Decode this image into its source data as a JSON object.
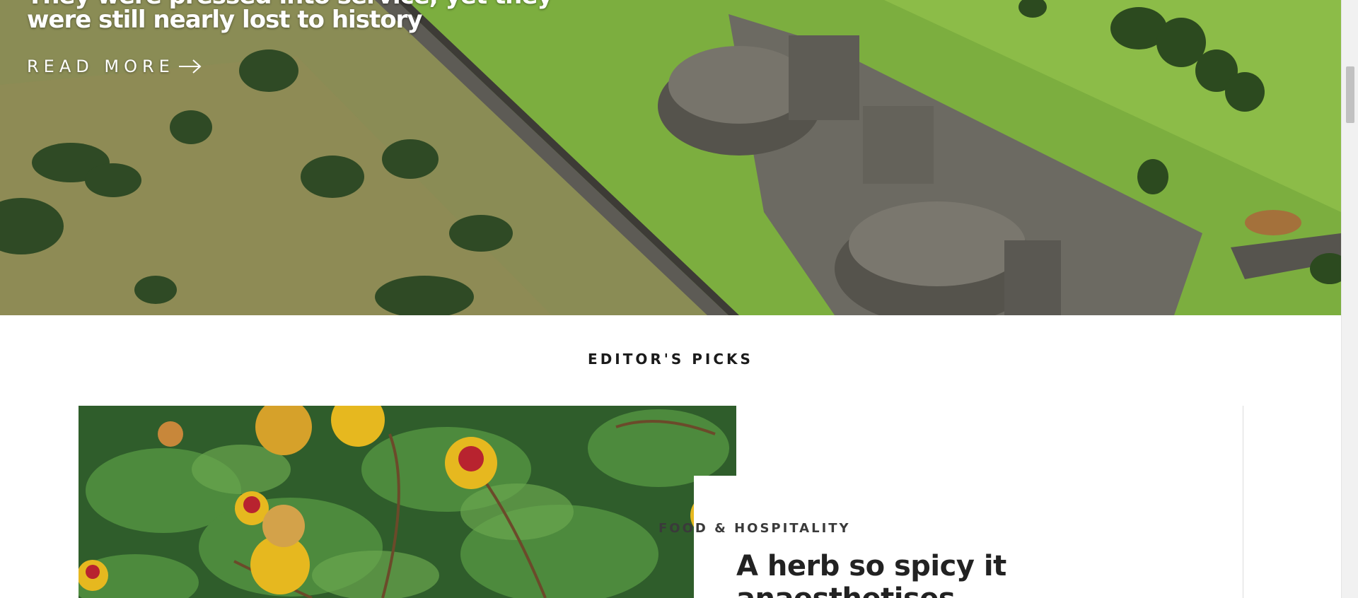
{
  "hero": {
    "title_prev_line": "They were pressed into service, yet they",
    "title": "were still nearly lost to history",
    "read_more": "READ MORE",
    "arrow_icon": "arrow-right-icon"
  },
  "editors_picks": {
    "heading": "EDITOR'S PICKS",
    "card": {
      "category": "FOOD & HOSPITALITY",
      "title": "A herb so spicy it anaesthetises"
    }
  },
  "colors": {
    "hero_grass": "#7cae3f",
    "stone": "#6c6a62",
    "text_dark": "#222222",
    "flower_yellow": "#e6b81f",
    "flower_red": "#b8232f"
  }
}
